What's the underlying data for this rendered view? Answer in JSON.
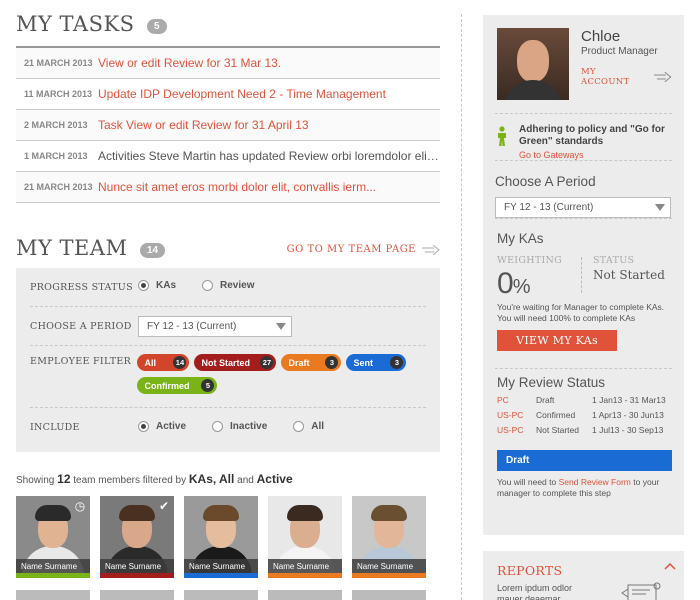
{
  "tasks": {
    "title": "MY TASKS",
    "count": "5",
    "items": [
      {
        "date": "21 MARCH 2013",
        "text": "View or edit Review for 31 Mar 13.",
        "style": "link"
      },
      {
        "date": "11 MARCH 2013",
        "text": "Update IDP Development Need 2 - Time Management",
        "style": "link"
      },
      {
        "date": "2 MARCH 2013",
        "text": "Task View or edit Review for 31 April 13",
        "style": "link"
      },
      {
        "date": "1 MARCH 2013",
        "text": "Activities Steve Martin has updated Review orbi loremdolor elit...",
        "style": "plain"
      },
      {
        "date": "21 MARCH 2013",
        "text": "Nunce sit amet eros morbi dolor elit, convallis ierm...",
        "style": "link"
      }
    ]
  },
  "team": {
    "title": "MY TEAM",
    "count": "14",
    "link_label": "GO TO MY TEAM PAGE",
    "filters": {
      "progress_label": "PROGRESS STATUS",
      "progress_options": [
        {
          "label": "KAs",
          "selected": true
        },
        {
          "label": "Review",
          "selected": false
        }
      ],
      "period_label": "CHOOSE A PERIOD",
      "period_value": "FY 12 - 13 (Current)",
      "employee_label": "EMPLOYEE FILTER",
      "employee_pills": [
        {
          "label": "All",
          "count": "14",
          "color": "#d2452a",
          "width": 52
        },
        {
          "label": "Not Started",
          "count": "27",
          "color": "#a31d1d",
          "width": 82
        },
        {
          "label": "Draft",
          "count": "3",
          "color": "#ea7a1f",
          "width": 60
        },
        {
          "label": "Sent",
          "count": "3",
          "color": "#1a6bd4",
          "width": 60
        },
        {
          "label": "Confirmed",
          "count": "5",
          "color": "#7ab317",
          "width": 80
        }
      ],
      "include_label": "INCLUDE",
      "include_options": [
        {
          "label": "Active",
          "selected": true
        },
        {
          "label": "Inactive",
          "selected": false
        },
        {
          "label": "All",
          "selected": false
        }
      ]
    },
    "showing": {
      "prefix": "Showing",
      "count": "12",
      "middle": "team members filtered by",
      "filter1": "KAs,",
      "filter2": "All",
      "conj": "and",
      "filter3": "Active"
    },
    "members": [
      {
        "name": "Name Surname",
        "status_color": "#7ab317",
        "bg": "#8a8a8a",
        "skin": "#e0b393",
        "hair": "#2a2a2a",
        "shirt": "#e8e8e8",
        "corner": "clock-icon",
        "corner_glyph": "◷"
      },
      {
        "name": "Name Surname",
        "status_color": "#a31d1d",
        "bg": "#7a7a7a",
        "skin": "#d9a88a",
        "hair": "#4a3020",
        "shirt": "#2a2a2a",
        "corner": "check-icon",
        "corner_glyph": "✔"
      },
      {
        "name": "Name Surname",
        "status_color": "#1a6bd4",
        "bg": "#9a9a9a",
        "skin": "#e4bc9e",
        "hair": "#6a4a2a",
        "shirt": "#1a1a1a",
        "corner": "",
        "corner_glyph": ""
      },
      {
        "name": "Name Surname",
        "status_color": "#ea7a1f",
        "bg": "#e8e8e8",
        "skin": "#dcae90",
        "hair": "#3a2a20",
        "shirt": "#f4f4f4",
        "corner": "",
        "corner_glyph": ""
      },
      {
        "name": "Name Surname",
        "status_color": "#ea7a1f",
        "bg": "#c8c8c8",
        "skin": "#e2b698",
        "hair": "#6a5030",
        "shirt": "#b8c8d8",
        "corner": "",
        "corner_glyph": ""
      }
    ]
  },
  "profile": {
    "name": "Chloe",
    "role": "Product Manager",
    "account_link": "MY ACCOUNT"
  },
  "policy": {
    "text": "Adhering to policy and \"Go for Green\" standards",
    "link": "Go to Gateways",
    "icon_color": "#7ab317"
  },
  "period": {
    "title": "Choose A Period",
    "value": "FY 12 - 13 (Current)"
  },
  "kas": {
    "title": "My KAs",
    "weighting_label": "WEIGHTING",
    "weighting_value": "0",
    "weighting_unit": "%",
    "status_label": "STATUS",
    "status_value": "Not Started",
    "note": "You're waiting for Manager to complete KAs. You will need 100% to complete KAs",
    "button": "VIEW MY KAs"
  },
  "review": {
    "title": "My Review Status",
    "rows": [
      {
        "code": "PC",
        "status": "Draft",
        "range": "1 Jan13 - 31 Mar13"
      },
      {
        "code": "US-PC",
        "status": "Confirmed",
        "range": "1 Apr13 - 30 Jun13"
      },
      {
        "code": "US-PC",
        "status": "Not Started",
        "range": "1 Jul13 - 30 Sep13"
      }
    ],
    "bar_label": "Draft",
    "note_prefix": "You will need to",
    "note_link": "Send Review Form",
    "note_suffix": "to your manager to complete this step"
  },
  "reports": {
    "title": "REPORTS",
    "text": "Lorem ipdum odlor mauer deaemar"
  },
  "colors": {
    "accent": "#e0533a",
    "panel": "#ececec",
    "blue": "#1a6bd4",
    "green": "#7ab317",
    "orange": "#ea7a1f",
    "dark_red": "#a31d1d"
  }
}
